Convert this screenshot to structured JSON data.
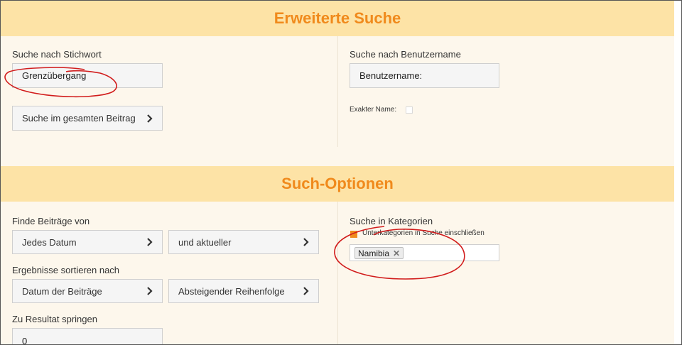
{
  "search_section": {
    "title": "Erweiterte Suche",
    "keyword_label": "Suche nach Stichwort",
    "keyword_value": "Grenzübergang",
    "scope_button": "Suche im gesamten Beitrag",
    "username_label": "Suche nach Benutzername",
    "username_placeholder": "Benutzername:",
    "exact_name_label": "Exakter Name:",
    "exact_name_checked": false
  },
  "options_section": {
    "title": "Such-Optionen",
    "find_posts_label": "Finde Beiträge von",
    "date_select": "Jedes Datum",
    "date_direction_select": "und aktueller",
    "sort_label": "Ergebnisse sortieren nach",
    "sort_field_select": "Datum der Beiträge",
    "sort_order_select": "Absteigender Reihenfolge",
    "jump_label": "Zu Resultat springen",
    "jump_value": "0",
    "categories_label": "Suche in Kategorien",
    "subcategories_label": "Unterkategorien in Suche einschließen",
    "subcategories_checked": true,
    "selected_categories": [
      "Namibia"
    ]
  },
  "icons": {
    "chevron": "chevron-right-icon",
    "remove_tag": "close-icon"
  },
  "colors": {
    "accent": "#f08a1c",
    "header_bg": "#fde3a6",
    "panel_bg": "#fdf7ec",
    "annotation": "#d11b1b"
  }
}
